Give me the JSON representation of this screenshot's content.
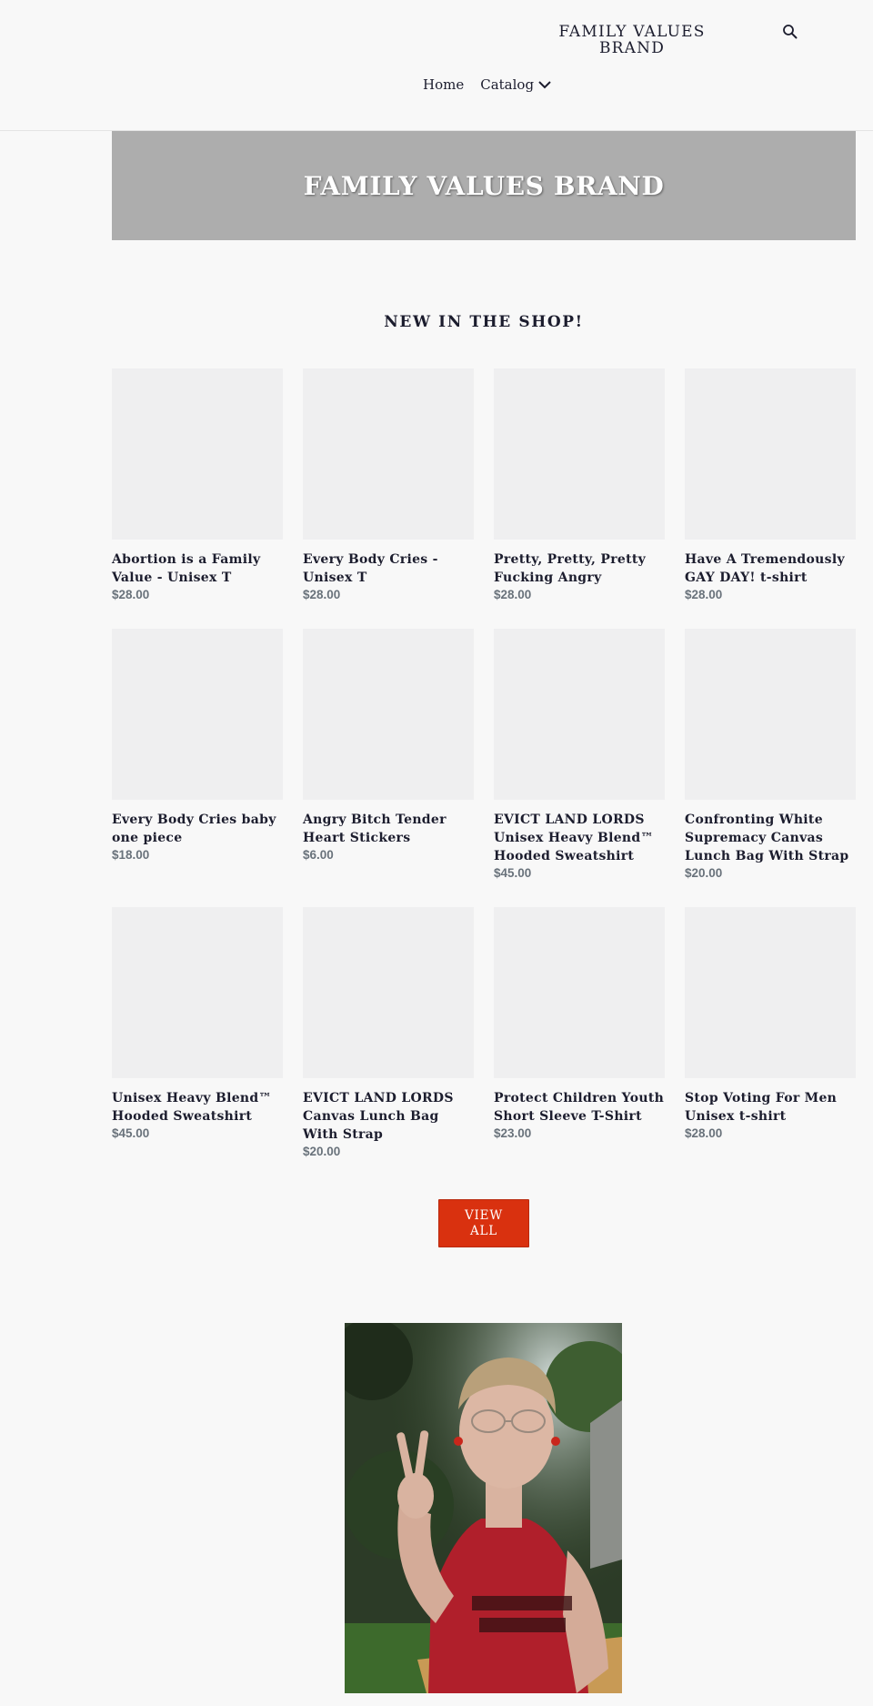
{
  "header": {
    "logo_line1": "FAMILY VALUES",
    "logo_line2": "BRAND",
    "search_icon": "search-icon",
    "nav": [
      {
        "label": "Home"
      },
      {
        "label": "Catalog",
        "icon": "chevron-down-icon"
      }
    ]
  },
  "hero": {
    "title": "FAMILY VALUES BRAND"
  },
  "featured": {
    "title": "NEW IN THE SHOP!",
    "products": [
      {
        "title": "Abortion is a Family Value - Unisex T",
        "price": "$28.00"
      },
      {
        "title": "Every Body Cries - Unisex T",
        "price": "$28.00"
      },
      {
        "title": "Pretty, Pretty, Pretty Fucking Angry",
        "price": "$28.00"
      },
      {
        "title": "Have A Tremendously GAY DAY! t-shirt",
        "price": "$28.00"
      },
      {
        "title": "Every Body Cries baby one piece",
        "price": "$18.00"
      },
      {
        "title": "Angry Bitch Tender Heart Stickers",
        "price": "$6.00"
      },
      {
        "title": "EVICT LAND LORDS Unisex Heavy Blend™ Hooded Sweatshirt",
        "price": "$45.00"
      },
      {
        "title": "Confronting White Supremacy Canvas Lunch Bag With Strap",
        "price": "$20.00"
      },
      {
        "title": "Unisex Heavy Blend™ Hooded Sweatshirt",
        "price": "$45.00"
      },
      {
        "title": "EVICT LAND LORDS Canvas Lunch Bag With Strap",
        "price": "$20.00"
      },
      {
        "title": "Protect Children Youth Short Sleeve T-Shirt",
        "price": "$23.00"
      },
      {
        "title": "Stop Voting For Men Unisex t-shirt",
        "price": "$28.00"
      }
    ],
    "view_all_line1": "VIEW",
    "view_all_line2": "ALL"
  },
  "colors": {
    "background": "#f8f8f8",
    "text": "#1c1d2e",
    "price": "#69727b",
    "button": "#d9310f",
    "hero": "#adadad",
    "placeholder": "#efeff0"
  }
}
